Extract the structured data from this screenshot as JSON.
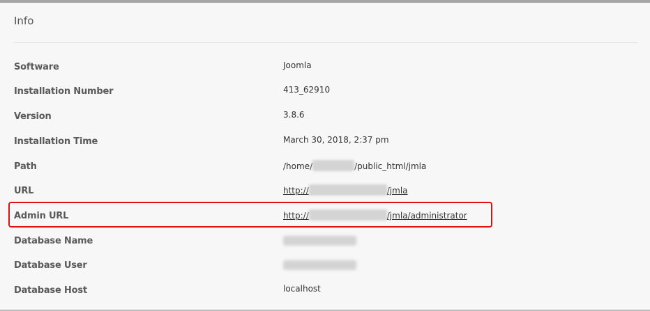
{
  "panel": {
    "title": "Info"
  },
  "rows": [
    {
      "label": "Software",
      "value": "Joomla"
    },
    {
      "label": "Installation Number",
      "value": "413_62910"
    },
    {
      "label": "Version",
      "value": "3.8.6"
    },
    {
      "label": "Installation Time",
      "value": "March 30, 2018, 2:37 pm"
    },
    {
      "label": "Path",
      "value_prefix": "/home/",
      "value_suffix": "/public_html/jmla"
    },
    {
      "label": "URL",
      "value_prefix": "http://",
      "value_suffix": "/jmla"
    },
    {
      "label": "Admin URL",
      "value_prefix": "http://",
      "value_suffix": "/jmla/administrator"
    },
    {
      "label": "Database Name",
      "value": ""
    },
    {
      "label": "Database User",
      "value": ""
    },
    {
      "label": "Database Host",
      "value": "localhost"
    }
  ],
  "highlight": {
    "color": "#e01010",
    "target_row": "Admin URL"
  }
}
